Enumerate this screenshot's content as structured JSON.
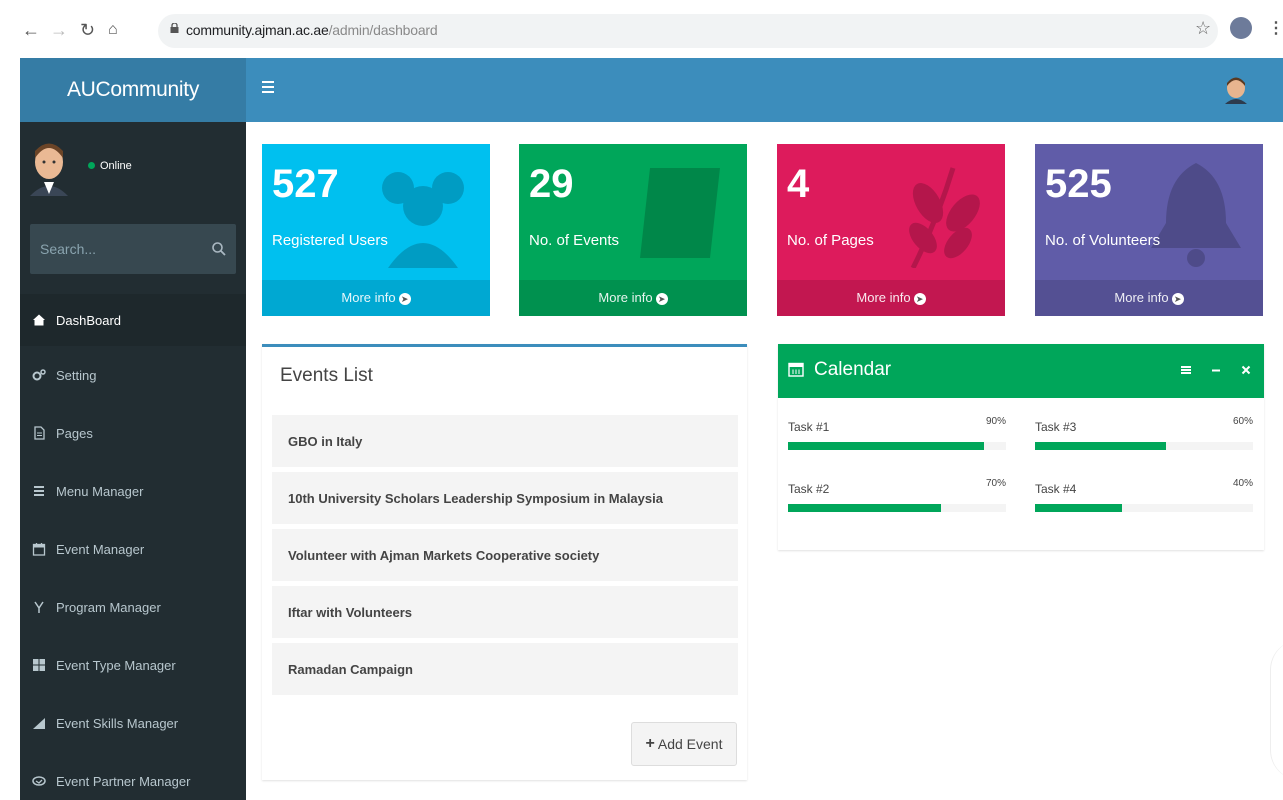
{
  "browser": {
    "url_host": "community.ajman.ac.ae",
    "url_path": "/admin/dashboard",
    "back_icon": "arrow-left-icon",
    "forward_icon": "arrow-right-icon",
    "reload_icon": "reload-icon",
    "home_icon": "home-icon"
  },
  "app": {
    "logo": "AUCommunity"
  },
  "user": {
    "status": "Online"
  },
  "search": {
    "placeholder": "Search..."
  },
  "sidebar": {
    "items": [
      {
        "label": "DashBoard",
        "icon": "dashboard-icon",
        "active": true
      },
      {
        "label": "Setting",
        "icon": "gears-icon"
      },
      {
        "label": "Pages",
        "icon": "file-icon"
      },
      {
        "label": "Menu Manager",
        "icon": "list-icon"
      },
      {
        "label": "Event Manager",
        "icon": "calendar-icon"
      },
      {
        "label": "Program Manager",
        "icon": "code-fork-icon"
      },
      {
        "label": "Event Type Manager",
        "icon": "th-large-icon"
      },
      {
        "label": "Event Skills Manager",
        "icon": "signal-icon"
      },
      {
        "label": "Event Partner Manager",
        "icon": "handshake-icon"
      }
    ]
  },
  "stats": [
    {
      "value": "527",
      "label": "Registered Users",
      "more": "More info",
      "color": "#00c0ef",
      "icon": "users-icon"
    },
    {
      "value": "29",
      "label": "No. of Events",
      "more": "More info",
      "color": "#00a65a",
      "icon": "book-icon"
    },
    {
      "value": "4",
      "label": "No. of Pages",
      "more": "More info",
      "color": "#dd1b5c",
      "icon": "leaf-icon"
    },
    {
      "value": "525",
      "label": "No. of Volunteers",
      "more": "More info",
      "color": "#605ca8",
      "icon": "bell-icon"
    }
  ],
  "events": {
    "title": "Events List",
    "items": [
      "GBO in Italy",
      "10th University Scholars Leadership Symposium in Malaysia",
      "Volunteer with Ajman Markets Cooperative society",
      "Iftar with Volunteers",
      "Ramadan Campaign"
    ],
    "add_label": "Add Event"
  },
  "calendar": {
    "title": "Calendar",
    "tasks": [
      {
        "label": "Task #1",
        "percent_text": "90%",
        "percent": 90
      },
      {
        "label": "Task #3",
        "percent_text": "60%",
        "percent": 60
      },
      {
        "label": "Task #2",
        "percent_text": "70%",
        "percent": 70
      },
      {
        "label": "Task #4",
        "percent_text": "40%",
        "percent": 40
      }
    ]
  },
  "colors": {
    "header": "#3c8dbc",
    "logo_bg": "#357ca5",
    "sidebar_bg": "#222d32",
    "accent_green": "#00a65a"
  }
}
